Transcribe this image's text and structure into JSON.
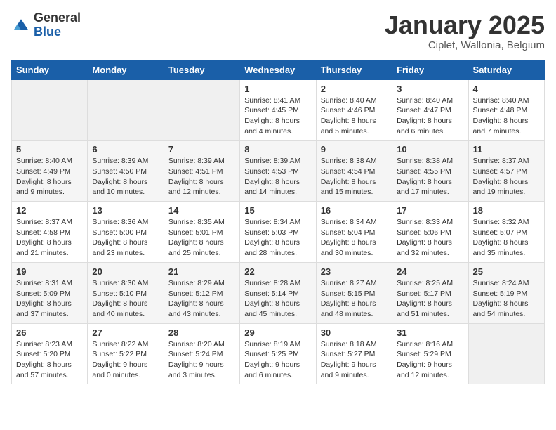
{
  "header": {
    "logo_general": "General",
    "logo_blue": "Blue",
    "title": "January 2025",
    "subtitle": "Ciplet, Wallonia, Belgium"
  },
  "weekdays": [
    "Sunday",
    "Monday",
    "Tuesday",
    "Wednesday",
    "Thursday",
    "Friday",
    "Saturday"
  ],
  "weeks": [
    {
      "days": [
        {
          "num": "",
          "sunrise": "",
          "sunset": "",
          "daylight": "",
          "empty": true
        },
        {
          "num": "",
          "sunrise": "",
          "sunset": "",
          "daylight": "",
          "empty": true
        },
        {
          "num": "",
          "sunrise": "",
          "sunset": "",
          "daylight": "",
          "empty": true
        },
        {
          "num": "1",
          "sunrise": "Sunrise: 8:41 AM",
          "sunset": "Sunset: 4:45 PM",
          "daylight": "Daylight: 8 hours and 4 minutes.",
          "empty": false
        },
        {
          "num": "2",
          "sunrise": "Sunrise: 8:40 AM",
          "sunset": "Sunset: 4:46 PM",
          "daylight": "Daylight: 8 hours and 5 minutes.",
          "empty": false
        },
        {
          "num": "3",
          "sunrise": "Sunrise: 8:40 AM",
          "sunset": "Sunset: 4:47 PM",
          "daylight": "Daylight: 8 hours and 6 minutes.",
          "empty": false
        },
        {
          "num": "4",
          "sunrise": "Sunrise: 8:40 AM",
          "sunset": "Sunset: 4:48 PM",
          "daylight": "Daylight: 8 hours and 7 minutes.",
          "empty": false
        }
      ]
    },
    {
      "days": [
        {
          "num": "5",
          "sunrise": "Sunrise: 8:40 AM",
          "sunset": "Sunset: 4:49 PM",
          "daylight": "Daylight: 8 hours and 9 minutes.",
          "empty": false
        },
        {
          "num": "6",
          "sunrise": "Sunrise: 8:39 AM",
          "sunset": "Sunset: 4:50 PM",
          "daylight": "Daylight: 8 hours and 10 minutes.",
          "empty": false
        },
        {
          "num": "7",
          "sunrise": "Sunrise: 8:39 AM",
          "sunset": "Sunset: 4:51 PM",
          "daylight": "Daylight: 8 hours and 12 minutes.",
          "empty": false
        },
        {
          "num": "8",
          "sunrise": "Sunrise: 8:39 AM",
          "sunset": "Sunset: 4:53 PM",
          "daylight": "Daylight: 8 hours and 14 minutes.",
          "empty": false
        },
        {
          "num": "9",
          "sunrise": "Sunrise: 8:38 AM",
          "sunset": "Sunset: 4:54 PM",
          "daylight": "Daylight: 8 hours and 15 minutes.",
          "empty": false
        },
        {
          "num": "10",
          "sunrise": "Sunrise: 8:38 AM",
          "sunset": "Sunset: 4:55 PM",
          "daylight": "Daylight: 8 hours and 17 minutes.",
          "empty": false
        },
        {
          "num": "11",
          "sunrise": "Sunrise: 8:37 AM",
          "sunset": "Sunset: 4:57 PM",
          "daylight": "Daylight: 8 hours and 19 minutes.",
          "empty": false
        }
      ]
    },
    {
      "days": [
        {
          "num": "12",
          "sunrise": "Sunrise: 8:37 AM",
          "sunset": "Sunset: 4:58 PM",
          "daylight": "Daylight: 8 hours and 21 minutes.",
          "empty": false
        },
        {
          "num": "13",
          "sunrise": "Sunrise: 8:36 AM",
          "sunset": "Sunset: 5:00 PM",
          "daylight": "Daylight: 8 hours and 23 minutes.",
          "empty": false
        },
        {
          "num": "14",
          "sunrise": "Sunrise: 8:35 AM",
          "sunset": "Sunset: 5:01 PM",
          "daylight": "Daylight: 8 hours and 25 minutes.",
          "empty": false
        },
        {
          "num": "15",
          "sunrise": "Sunrise: 8:34 AM",
          "sunset": "Sunset: 5:03 PM",
          "daylight": "Daylight: 8 hours and 28 minutes.",
          "empty": false
        },
        {
          "num": "16",
          "sunrise": "Sunrise: 8:34 AM",
          "sunset": "Sunset: 5:04 PM",
          "daylight": "Daylight: 8 hours and 30 minutes.",
          "empty": false
        },
        {
          "num": "17",
          "sunrise": "Sunrise: 8:33 AM",
          "sunset": "Sunset: 5:06 PM",
          "daylight": "Daylight: 8 hours and 32 minutes.",
          "empty": false
        },
        {
          "num": "18",
          "sunrise": "Sunrise: 8:32 AM",
          "sunset": "Sunset: 5:07 PM",
          "daylight": "Daylight: 8 hours and 35 minutes.",
          "empty": false
        }
      ]
    },
    {
      "days": [
        {
          "num": "19",
          "sunrise": "Sunrise: 8:31 AM",
          "sunset": "Sunset: 5:09 PM",
          "daylight": "Daylight: 8 hours and 37 minutes.",
          "empty": false
        },
        {
          "num": "20",
          "sunrise": "Sunrise: 8:30 AM",
          "sunset": "Sunset: 5:10 PM",
          "daylight": "Daylight: 8 hours and 40 minutes.",
          "empty": false
        },
        {
          "num": "21",
          "sunrise": "Sunrise: 8:29 AM",
          "sunset": "Sunset: 5:12 PM",
          "daylight": "Daylight: 8 hours and 43 minutes.",
          "empty": false
        },
        {
          "num": "22",
          "sunrise": "Sunrise: 8:28 AM",
          "sunset": "Sunset: 5:14 PM",
          "daylight": "Daylight: 8 hours and 45 minutes.",
          "empty": false
        },
        {
          "num": "23",
          "sunrise": "Sunrise: 8:27 AM",
          "sunset": "Sunset: 5:15 PM",
          "daylight": "Daylight: 8 hours and 48 minutes.",
          "empty": false
        },
        {
          "num": "24",
          "sunrise": "Sunrise: 8:25 AM",
          "sunset": "Sunset: 5:17 PM",
          "daylight": "Daylight: 8 hours and 51 minutes.",
          "empty": false
        },
        {
          "num": "25",
          "sunrise": "Sunrise: 8:24 AM",
          "sunset": "Sunset: 5:19 PM",
          "daylight": "Daylight: 8 hours and 54 minutes.",
          "empty": false
        }
      ]
    },
    {
      "days": [
        {
          "num": "26",
          "sunrise": "Sunrise: 8:23 AM",
          "sunset": "Sunset: 5:20 PM",
          "daylight": "Daylight: 8 hours and 57 minutes.",
          "empty": false
        },
        {
          "num": "27",
          "sunrise": "Sunrise: 8:22 AM",
          "sunset": "Sunset: 5:22 PM",
          "daylight": "Daylight: 9 hours and 0 minutes.",
          "empty": false
        },
        {
          "num": "28",
          "sunrise": "Sunrise: 8:20 AM",
          "sunset": "Sunset: 5:24 PM",
          "daylight": "Daylight: 9 hours and 3 minutes.",
          "empty": false
        },
        {
          "num": "29",
          "sunrise": "Sunrise: 8:19 AM",
          "sunset": "Sunset: 5:25 PM",
          "daylight": "Daylight: 9 hours and 6 minutes.",
          "empty": false
        },
        {
          "num": "30",
          "sunrise": "Sunrise: 8:18 AM",
          "sunset": "Sunset: 5:27 PM",
          "daylight": "Daylight: 9 hours and 9 minutes.",
          "empty": false
        },
        {
          "num": "31",
          "sunrise": "Sunrise: 8:16 AM",
          "sunset": "Sunset: 5:29 PM",
          "daylight": "Daylight: 9 hours and 12 minutes.",
          "empty": false
        },
        {
          "num": "",
          "sunrise": "",
          "sunset": "",
          "daylight": "",
          "empty": true
        }
      ]
    }
  ]
}
